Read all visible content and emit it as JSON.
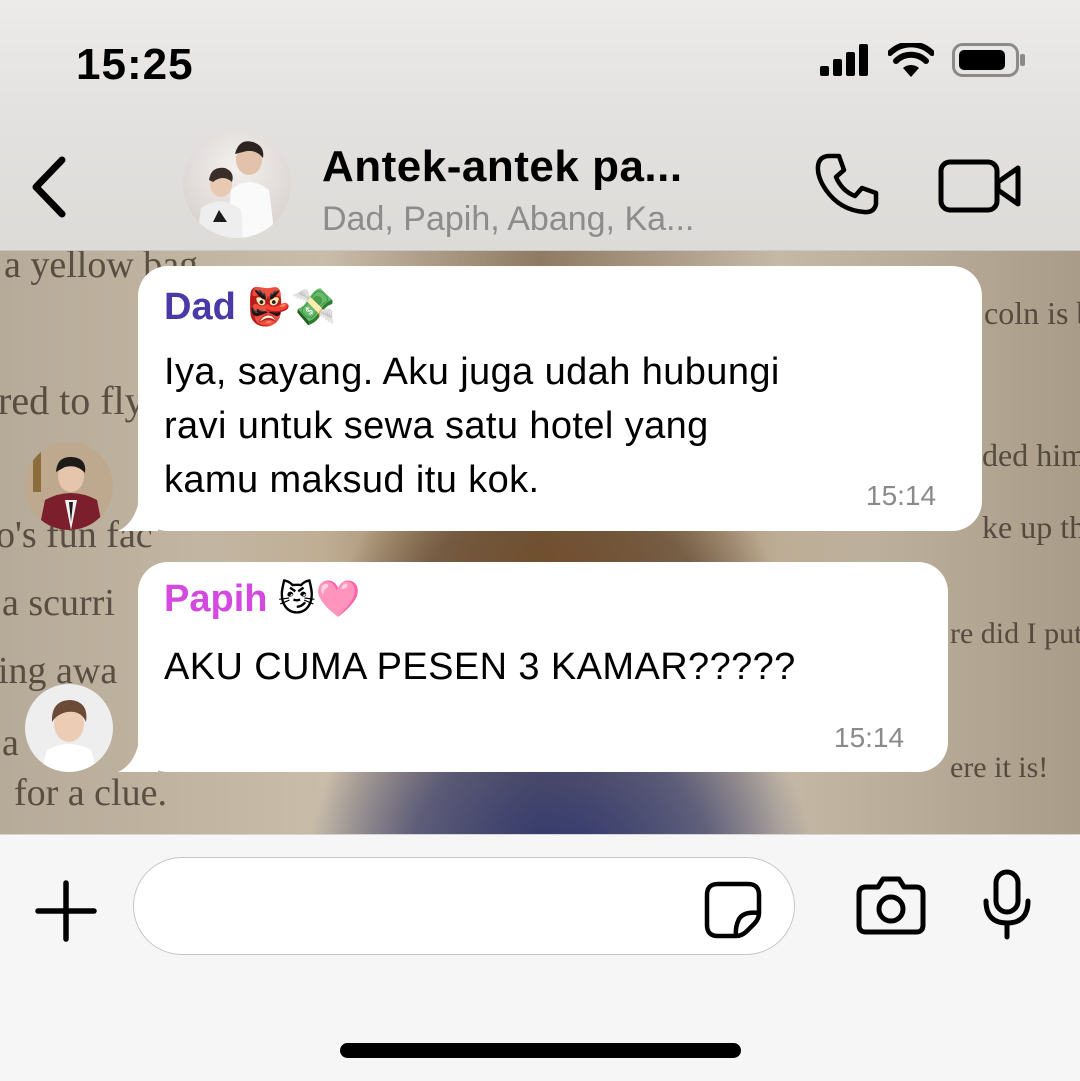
{
  "status_bar": {
    "time": "15:25"
  },
  "header": {
    "title": "Antek-antek pa...",
    "subtitle": "Dad, Papih, Abang, Ka..."
  },
  "background_text": [
    "a yellow bag.",
    "red to fly",
    "o's fun fac",
    "a scurri",
    "ing awa",
    "a",
    "for a clue.",
    "coln is b",
    "ded him t",
    "ke up the",
    "re did I put t",
    "ere it is!"
  ],
  "messages": [
    {
      "sender": "Dad",
      "sender_emoji": "👺💸",
      "sender_color": "#4a3aa6",
      "lines": [
        "Iya, sayang. Aku juga udah hubungi",
        "ravi untuk sewa satu hotel yang",
        "kamu maksud itu kok."
      ],
      "time": "15:14"
    },
    {
      "sender": "Papih",
      "sender_emoji": "😼🩷",
      "sender_color": "#d449e0",
      "lines": [
        "AKU CUMA PESEN 3 KAMAR?????"
      ],
      "time": "15:14"
    }
  ],
  "input": {
    "placeholder": ""
  },
  "colors": {
    "bubble": "#ffffff",
    "timestamp": "#8a8a8a",
    "subtitle": "#8c8c8c"
  }
}
